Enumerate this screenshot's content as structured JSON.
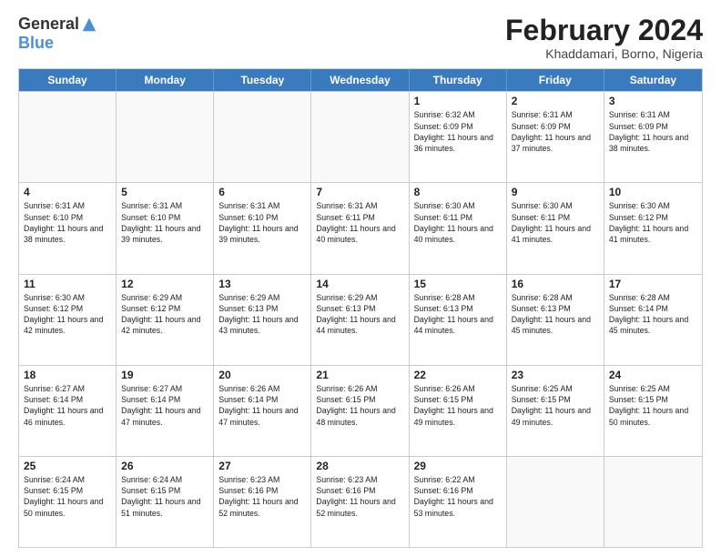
{
  "logo": {
    "general": "General",
    "blue": "Blue"
  },
  "title": "February 2024",
  "subtitle": "Khaddamari, Borno, Nigeria",
  "days": [
    "Sunday",
    "Monday",
    "Tuesday",
    "Wednesday",
    "Thursday",
    "Friday",
    "Saturday"
  ],
  "weeks": [
    [
      {
        "day": "",
        "info": ""
      },
      {
        "day": "",
        "info": ""
      },
      {
        "day": "",
        "info": ""
      },
      {
        "day": "",
        "info": ""
      },
      {
        "day": "1",
        "info": "Sunrise: 6:32 AM\nSunset: 6:09 PM\nDaylight: 11 hours and 36 minutes."
      },
      {
        "day": "2",
        "info": "Sunrise: 6:31 AM\nSunset: 6:09 PM\nDaylight: 11 hours and 37 minutes."
      },
      {
        "day": "3",
        "info": "Sunrise: 6:31 AM\nSunset: 6:09 PM\nDaylight: 11 hours and 38 minutes."
      }
    ],
    [
      {
        "day": "4",
        "info": "Sunrise: 6:31 AM\nSunset: 6:10 PM\nDaylight: 11 hours and 38 minutes."
      },
      {
        "day": "5",
        "info": "Sunrise: 6:31 AM\nSunset: 6:10 PM\nDaylight: 11 hours and 39 minutes."
      },
      {
        "day": "6",
        "info": "Sunrise: 6:31 AM\nSunset: 6:10 PM\nDaylight: 11 hours and 39 minutes."
      },
      {
        "day": "7",
        "info": "Sunrise: 6:31 AM\nSunset: 6:11 PM\nDaylight: 11 hours and 40 minutes."
      },
      {
        "day": "8",
        "info": "Sunrise: 6:30 AM\nSunset: 6:11 PM\nDaylight: 11 hours and 40 minutes."
      },
      {
        "day": "9",
        "info": "Sunrise: 6:30 AM\nSunset: 6:11 PM\nDaylight: 11 hours and 41 minutes."
      },
      {
        "day": "10",
        "info": "Sunrise: 6:30 AM\nSunset: 6:12 PM\nDaylight: 11 hours and 41 minutes."
      }
    ],
    [
      {
        "day": "11",
        "info": "Sunrise: 6:30 AM\nSunset: 6:12 PM\nDaylight: 11 hours and 42 minutes."
      },
      {
        "day": "12",
        "info": "Sunrise: 6:29 AM\nSunset: 6:12 PM\nDaylight: 11 hours and 42 minutes."
      },
      {
        "day": "13",
        "info": "Sunrise: 6:29 AM\nSunset: 6:13 PM\nDaylight: 11 hours and 43 minutes."
      },
      {
        "day": "14",
        "info": "Sunrise: 6:29 AM\nSunset: 6:13 PM\nDaylight: 11 hours and 44 minutes."
      },
      {
        "day": "15",
        "info": "Sunrise: 6:28 AM\nSunset: 6:13 PM\nDaylight: 11 hours and 44 minutes."
      },
      {
        "day": "16",
        "info": "Sunrise: 6:28 AM\nSunset: 6:13 PM\nDaylight: 11 hours and 45 minutes."
      },
      {
        "day": "17",
        "info": "Sunrise: 6:28 AM\nSunset: 6:14 PM\nDaylight: 11 hours and 45 minutes."
      }
    ],
    [
      {
        "day": "18",
        "info": "Sunrise: 6:27 AM\nSunset: 6:14 PM\nDaylight: 11 hours and 46 minutes."
      },
      {
        "day": "19",
        "info": "Sunrise: 6:27 AM\nSunset: 6:14 PM\nDaylight: 11 hours and 47 minutes."
      },
      {
        "day": "20",
        "info": "Sunrise: 6:26 AM\nSunset: 6:14 PM\nDaylight: 11 hours and 47 minutes."
      },
      {
        "day": "21",
        "info": "Sunrise: 6:26 AM\nSunset: 6:15 PM\nDaylight: 11 hours and 48 minutes."
      },
      {
        "day": "22",
        "info": "Sunrise: 6:26 AM\nSunset: 6:15 PM\nDaylight: 11 hours and 49 minutes."
      },
      {
        "day": "23",
        "info": "Sunrise: 6:25 AM\nSunset: 6:15 PM\nDaylight: 11 hours and 49 minutes."
      },
      {
        "day": "24",
        "info": "Sunrise: 6:25 AM\nSunset: 6:15 PM\nDaylight: 11 hours and 50 minutes."
      }
    ],
    [
      {
        "day": "25",
        "info": "Sunrise: 6:24 AM\nSunset: 6:15 PM\nDaylight: 11 hours and 50 minutes."
      },
      {
        "day": "26",
        "info": "Sunrise: 6:24 AM\nSunset: 6:15 PM\nDaylight: 11 hours and 51 minutes."
      },
      {
        "day": "27",
        "info": "Sunrise: 6:23 AM\nSunset: 6:16 PM\nDaylight: 11 hours and 52 minutes."
      },
      {
        "day": "28",
        "info": "Sunrise: 6:23 AM\nSunset: 6:16 PM\nDaylight: 11 hours and 52 minutes."
      },
      {
        "day": "29",
        "info": "Sunrise: 6:22 AM\nSunset: 6:16 PM\nDaylight: 11 hours and 53 minutes."
      },
      {
        "day": "",
        "info": ""
      },
      {
        "day": "",
        "info": ""
      }
    ]
  ]
}
